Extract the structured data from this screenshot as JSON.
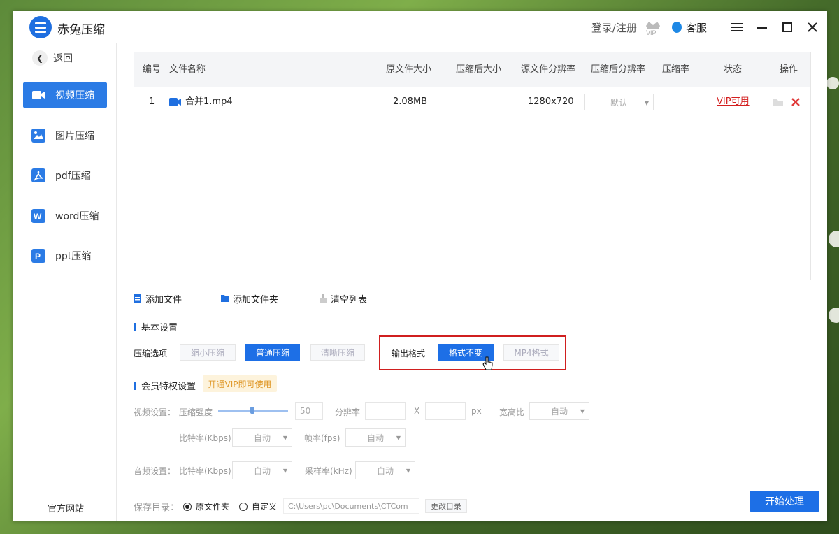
{
  "app": {
    "title": "赤兔压缩"
  },
  "titlebar": {
    "login": "登录/注册",
    "vip_label": "VIP",
    "service": "客服",
    "menu_icon": "menu-icon",
    "minimize_icon": "minimize-icon",
    "maximize_icon": "maximize-icon",
    "close_icon": "close-icon"
  },
  "sidebar": {
    "back": "返回",
    "items": [
      {
        "label": "视频压缩",
        "icon": "video-icon",
        "active": true
      },
      {
        "label": "图片压缩",
        "icon": "image-icon",
        "active": false
      },
      {
        "label": "pdf压缩",
        "icon": "pdf-icon",
        "active": false
      },
      {
        "label": "word压缩",
        "icon": "word-icon",
        "active": false
      },
      {
        "label": "ppt压缩",
        "icon": "ppt-icon",
        "active": false
      }
    ],
    "official_site": "官方网站"
  },
  "table": {
    "headers": [
      "编号",
      "文件名称",
      "原文件大小",
      "压缩后大小",
      "源文件分辨率",
      "压缩后分辨率",
      "压缩率",
      "状态",
      "操作"
    ],
    "rows": [
      {
        "index": "1",
        "name": "合并1.mp4",
        "original_size": "2.08MB",
        "compressed_size": "",
        "source_resolution": "1280x720",
        "target_resolution": "默认",
        "ratio": "",
        "status": "VIP可用"
      }
    ]
  },
  "actions": {
    "add_file": "添加文件",
    "add_folder": "添加文件夹",
    "clear_list": "清空列表"
  },
  "basic_settings": {
    "title": "基本设置",
    "compress_option_label": "压缩选项",
    "options": [
      "缩小压缩",
      "普通压缩",
      "清晰压缩"
    ],
    "selected_option": "普通压缩",
    "output_format_label": "输出格式",
    "formats": [
      "格式不变",
      "MP4格式"
    ],
    "selected_format": "格式不变"
  },
  "vip_settings": {
    "title": "会员特权设置",
    "tag": "开通VIP即可使用",
    "video_label": "视频设置：",
    "strength_label": "压缩强度",
    "strength_value": "50",
    "strength_fraction": 0.5,
    "resolution_label": "分辨率",
    "x_label": "X",
    "px_label": "px",
    "aspect_label": "宽高比",
    "aspect_value": "自动",
    "bitrate_label": "比特率(Kbps)",
    "bitrate_value": "自动",
    "fps_label": "帧率(fps)",
    "fps_value": "自动",
    "audio_label": "音频设置：",
    "audio_bitrate_label": "比特率(Kbps)",
    "audio_bitrate_value": "自动",
    "sample_label": "采样率(kHz)",
    "sample_value": "自动"
  },
  "save": {
    "label": "保存目录：",
    "original_folder": "原文件夹",
    "custom": "自定义",
    "path": "C:\\Users\\pc\\Documents\\CTCom",
    "change_dir": "更改目录"
  },
  "start_button": "开始处理",
  "colors": {
    "primary": "#1d6fe6",
    "highlight_box": "#d01f1f",
    "vip_red": "#d41f1f"
  }
}
